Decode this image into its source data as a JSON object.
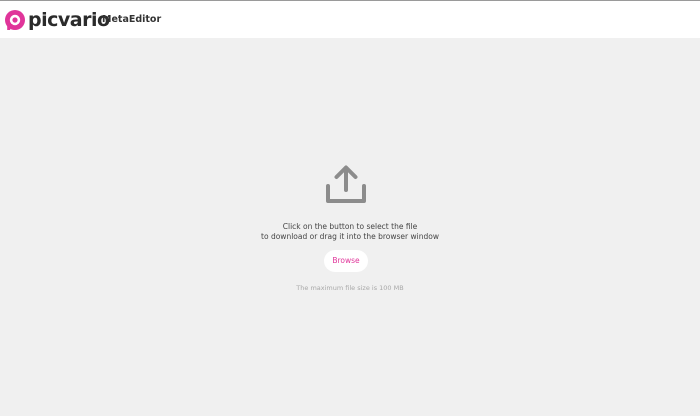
{
  "header": {
    "logo_text": "picvario",
    "app_name": "MetaEditor",
    "brand_color": "#e0359a"
  },
  "upload": {
    "icon": "upload-icon",
    "instruction_line1": "Click on the button to select the file",
    "instruction_line2": "to download or drag it into the browser window",
    "browse_label": "Browse",
    "max_size_text": "The maximum file size is 100 MB"
  }
}
